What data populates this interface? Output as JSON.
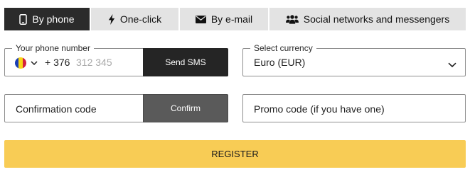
{
  "tabs": [
    {
      "label": "By phone",
      "icon": "phone-icon",
      "active": true
    },
    {
      "label": "One-click",
      "icon": "lightning-icon",
      "active": false
    },
    {
      "label": "By e-mail",
      "icon": "envelope-icon",
      "active": false
    },
    {
      "label": "Social networks and messengers",
      "icon": "users-icon",
      "active": false
    }
  ],
  "phone": {
    "legend": "Your phone number",
    "country_code": "+ 376",
    "placeholder": "312 345",
    "flag_icon": "andorra-flag-icon",
    "send_label": "Send SMS"
  },
  "currency": {
    "legend": "Select currency",
    "selected": "Euro (EUR)"
  },
  "confirmation": {
    "placeholder": "Confirmation code",
    "confirm_label": "Confirm"
  },
  "promo": {
    "placeholder": "Promo code (if you have one)"
  },
  "register_label": "REGISTER",
  "colors": {
    "active_tab": "#2b2b2b",
    "inactive_tab": "#e3e3e3",
    "send_button": "#252525",
    "confirm_button": "#5a5a5a",
    "register_button": "#f8cc55"
  }
}
